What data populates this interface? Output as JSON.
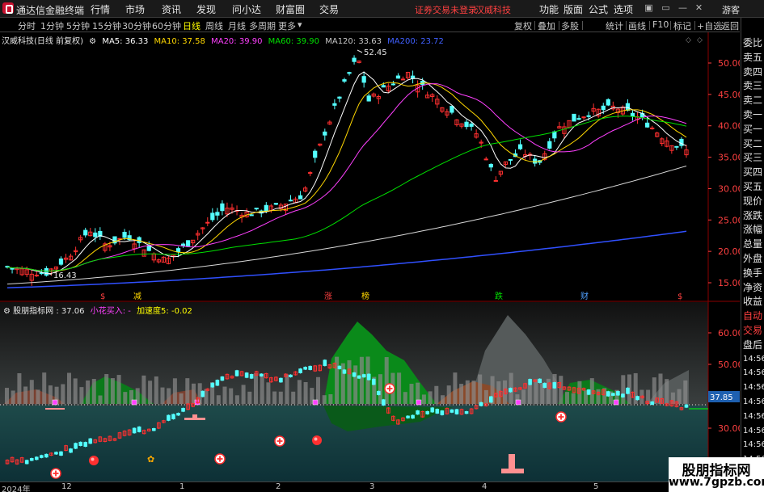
{
  "titlebar": {
    "app_title": "通达信金融终端",
    "menus": [
      "行情",
      "市场",
      "资讯",
      "发现",
      "问小达",
      "财富圈",
      "交易"
    ],
    "login_status": "证券交易未登录",
    "stock_name": "汉威科技",
    "right_menus": [
      "功能",
      "版面",
      "公式",
      "选项"
    ],
    "guest": "游客"
  },
  "periods": {
    "items": [
      "分时",
      "1分钟",
      "5分钟",
      "15分钟",
      "30分钟",
      "60分钟",
      "日线",
      "周线",
      "月线",
      "多周期",
      "更多"
    ],
    "active": "日线"
  },
  "tools": [
    "复权",
    "叠加",
    "多股",
    "统计",
    "画线",
    "F10",
    "标记",
    "+自选",
    "返回"
  ],
  "main_chart": {
    "title": "汉威科技(日线 前复权)",
    "ma": [
      {
        "label": "MA5: 36.33",
        "color": "#ffffff"
      },
      {
        "label": "MA10: 37.58",
        "color": "#ffd700"
      },
      {
        "label": "MA20: 39.90",
        "color": "#ff40ff"
      },
      {
        "label": "MA60: 39.90",
        "color": "#00e000"
      },
      {
        "label": "MA120: 33.63",
        "color": "#c8c8c8"
      },
      {
        "label": "MA200: 23.72",
        "color": "#4060ff"
      }
    ],
    "price_high_label": "52.45",
    "price_low_label": "16.43",
    "y_labels": [
      "50.00",
      "45.00",
      "40.00",
      "35.00",
      "30.00",
      "25.00",
      "20.00",
      "15.00"
    ],
    "event_markers": [
      {
        "text": "$",
        "color": "#ff4040"
      },
      {
        "text": "减",
        "color": "#ffd700"
      },
      {
        "text": "涨",
        "color": "#ff4040"
      },
      {
        "text": "榜",
        "color": "#ffd700"
      },
      {
        "text": "跌",
        "color": "#00e000"
      },
      {
        "text": "财",
        "color": "#4fa0ff"
      },
      {
        "text": "$",
        "color": "#ff4040"
      }
    ]
  },
  "indicator": {
    "name": "股朋指标网",
    "value": ": 37.06",
    "buy_label": "小花买入: -",
    "accel_label": "加速度5: -0.02",
    "y_labels": [
      "60.00",
      "50.00",
      "40.00",
      "30.00"
    ],
    "current_value": "37.85"
  },
  "right_panel": {
    "items": [
      "委比",
      "卖五",
      "卖四",
      "卖三",
      "卖二",
      "卖一",
      "买一",
      "买二",
      "买三",
      "买四",
      "买五",
      "现价",
      "涨跌",
      "涨幅",
      "总量",
      "外盘",
      "换手",
      "净资",
      "收益",
      "自动",
      "交易",
      "盘后",
      "14:56",
      "14:56",
      "14:56",
      "14:56",
      "14:56",
      "14:56",
      "14:56",
      "14:56",
      "14:56"
    ]
  },
  "xaxis": {
    "labels": [
      "2024年",
      "12",
      "1",
      "2",
      "3",
      "4",
      "5"
    ]
  },
  "watermark": {
    "line1": "股朋指标网",
    "line2": "www.7gpzb.com"
  },
  "colors": {
    "up": "#ff3030",
    "down": "#54ffff",
    "axis_text": "#ff4040",
    "grid": "#8b0000"
  }
}
